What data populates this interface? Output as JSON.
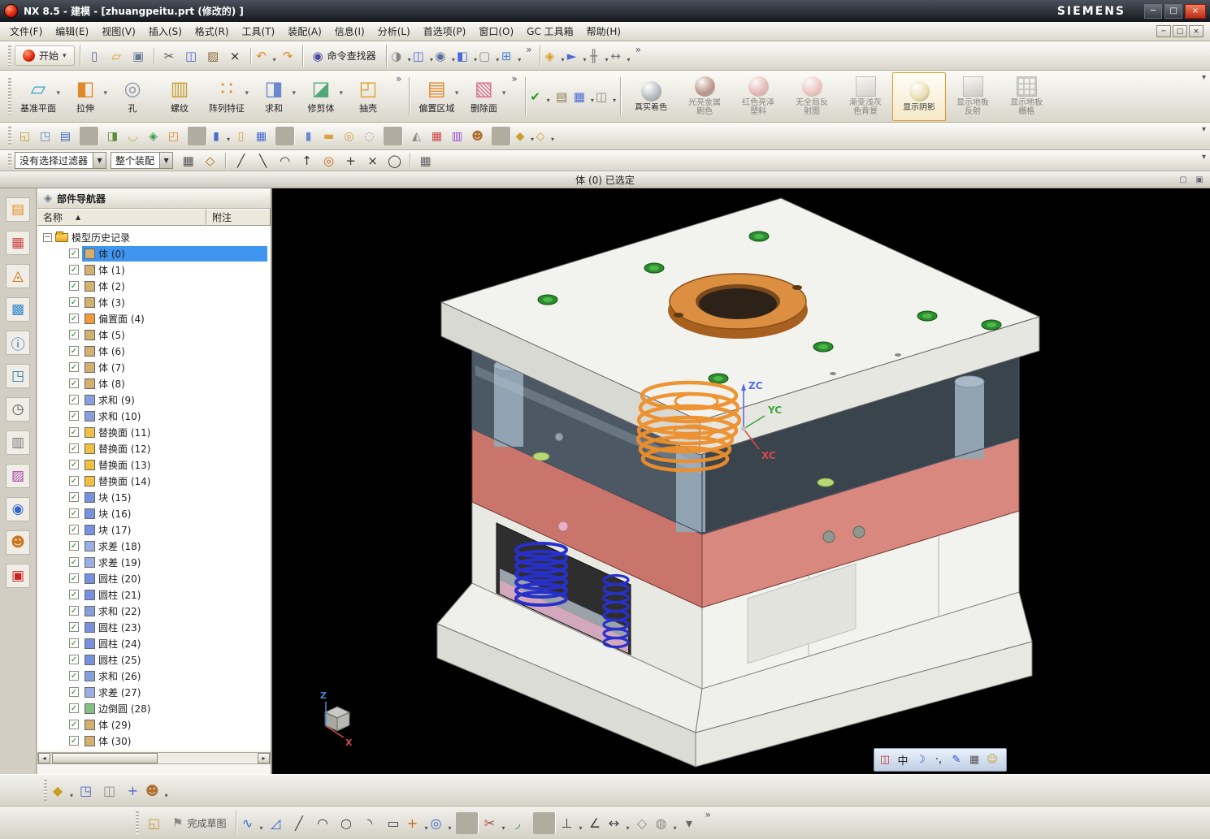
{
  "ui": {
    "overflow_glyph": "»"
  },
  "title_bar": {
    "app_title": "NX 8.5 - 建模 - [zhuangpeitu.prt (修改的) ]",
    "brand": "SIEMENS",
    "buttons": {
      "minimize": "─",
      "restore": "□",
      "close": "×"
    }
  },
  "menu_bar": {
    "items": [
      {
        "name": "menu-file",
        "label": "文件(F)"
      },
      {
        "name": "menu-edit",
        "label": "编辑(E)"
      },
      {
        "name": "menu-view",
        "label": "视图(V)"
      },
      {
        "name": "menu-insert",
        "label": "插入(S)"
      },
      {
        "name": "menu-format",
        "label": "格式(R)"
      },
      {
        "name": "menu-tools",
        "label": "工具(T)"
      },
      {
        "name": "menu-assemblies",
        "label": "装配(A)"
      },
      {
        "name": "menu-information",
        "label": "信息(I)"
      },
      {
        "name": "menu-analysis",
        "label": "分析(L)"
      },
      {
        "name": "menu-preferences",
        "label": "首选项(P)"
      },
      {
        "name": "menu-window",
        "label": "窗口(O)"
      },
      {
        "name": "menu-gc-toolbox",
        "label": "GC 工具箱"
      },
      {
        "name": "menu-help",
        "label": "帮助(H)"
      }
    ],
    "doc_buttons": {
      "minimize": "─",
      "restore": "□",
      "close": "×"
    }
  },
  "toolbar_main": {
    "start_label": "开始",
    "finder_glyph": "◉",
    "command_finder_label": "命令查找器",
    "icons_file": [
      {
        "name": "new-file-icon",
        "glyph": "▯",
        "fg": "#5a6a9a"
      },
      {
        "name": "open-icon",
        "glyph": "▱",
        "fg": "#d8a020"
      },
      {
        "name": "save-icon",
        "glyph": "▣",
        "fg": "#6a7a92"
      },
      {
        "sep": true
      },
      {
        "name": "cut-icon",
        "glyph": "✂",
        "fg": "#555555"
      },
      {
        "name": "copy-icon",
        "glyph": "◫",
        "fg": "#4a6ad8"
      },
      {
        "name": "paste-icon",
        "glyph": "▨",
        "fg": "#8a6a3a"
      },
      {
        "name": "delete-icon",
        "glyph": "×",
        "fg": "#222222"
      },
      {
        "sep": true
      },
      {
        "name": "undo-icon",
        "glyph": "↶",
        "fg": "#e08a20",
        "dd": true
      },
      {
        "name": "redo-icon",
        "glyph": "↷",
        "fg": "#e08a20"
      }
    ],
    "icons_view": [
      {
        "name": "rendering-style-icon",
        "glyph": "◑",
        "fg": "#888888",
        "dd": true
      },
      {
        "name": "window-layout-icon",
        "glyph": "◫",
        "fg": "#4a6ad8",
        "dd": true
      },
      {
        "name": "fit-view-icon",
        "glyph": "◉",
        "fg": "#5a6a9a",
        "dd": true
      },
      {
        "name": "cube-view-icon",
        "glyph": "◧",
        "fg": "#4a6ad8",
        "dd": true
      },
      {
        "name": "pane-icon",
        "glyph": "▢",
        "fg": "#888888",
        "dd": true
      },
      {
        "name": "new-window-icon",
        "glyph": "⊞",
        "fg": "#4a8ad8",
        "dd": true
      }
    ],
    "icons_tools": [
      {
        "name": "visualization-icon",
        "glyph": "◈",
        "fg": "#d8a020",
        "dd": true
      },
      {
        "name": "navigate-icon",
        "glyph": "►",
        "fg": "#4a6ad8",
        "dd": true
      },
      {
        "name": "measure-distance-icon",
        "glyph": "╫",
        "fg": "#777777",
        "dd": true
      },
      {
        "name": "ruler-icon",
        "glyph": "↔",
        "fg": "#777777",
        "dd": true
      }
    ]
  },
  "feature_toolbar": {
    "buttons": [
      {
        "name": "datum-plane-button",
        "label": "基准平面",
        "glyph": "▱",
        "fg": "#38a0c8",
        "dd": true
      },
      {
        "name": "extrude-button",
        "label": "拉伸",
        "glyph": "◧",
        "fg": "#e0882a",
        "dd": true
      },
      {
        "name": "hole-button",
        "label": "孔",
        "glyph": "◎",
        "fg": "#8a98a8"
      },
      {
        "name": "thread-button",
        "label": "螺纹",
        "glyph": "▥",
        "fg": "#c8a030"
      },
      {
        "name": "pattern-feature-button",
        "label": "阵列特征",
        "glyph": "∷",
        "fg": "#e0882a",
        "dd": true
      },
      {
        "name": "unite-button",
        "label": "求和",
        "glyph": "◨",
        "fg": "#6a8ad0",
        "dd": true
      },
      {
        "name": "trim-body-button",
        "label": "修剪体",
        "glyph": "◪",
        "fg": "#50a878",
        "dd": true
      },
      {
        "name": "shell-button",
        "label": "抽壳",
        "glyph": "◰",
        "fg": "#e0a02a"
      }
    ],
    "buttons2": [
      {
        "name": "offset-region-button",
        "label": "偏置区域",
        "glyph": "▤",
        "fg": "#e0882a",
        "dd": true
      },
      {
        "name": "delete-face-button",
        "label": "删除面",
        "glyph": "▧",
        "fg": "#d86a8a",
        "dd": true
      }
    ],
    "mid_icons": [
      {
        "name": "ok-check-icon",
        "glyph": "✔",
        "fg": "#2a9a2a",
        "dd": true
      },
      {
        "name": "spreadsheet-icon",
        "glyph": "▤",
        "fg": "#8a7a50"
      },
      {
        "name": "grid-tool-icon",
        "glyph": "▦",
        "fg": "#4a6ad8",
        "dd": true
      },
      {
        "name": "measure-tool-icon",
        "glyph": "◫",
        "fg": "#888888",
        "dd": true
      }
    ]
  },
  "render_toolbar": {
    "buttons": [
      {
        "name": "true-shading-button",
        "label": "真实着色",
        "kind": "sphere",
        "fg": "#b4b8bc",
        "on": true,
        "dd": false
      },
      {
        "name": "bright-metal-button",
        "label": "光亮金属刷色",
        "kind": "sphere",
        "fg": "#8a4a3a"
      },
      {
        "name": "red-gloss-plastic-button",
        "label": "红色亮泽塑料",
        "kind": "sphere",
        "fg": "#d88a8a"
      },
      {
        "name": "no-global-reflection-button",
        "label": "无全局反射图",
        "kind": "sphere",
        "fg": "#e8a0a0"
      },
      {
        "name": "gradient-gray-background-button",
        "label": "渐变浅灰色背景",
        "kind": "square",
        "fg": "#bcbcbc"
      },
      {
        "name": "show-shadow-button",
        "label": "显示阴影",
        "kind": "sphere",
        "fg": "#e8ddb0",
        "active": true
      },
      {
        "name": "floor-reflection-button",
        "label": "显示地板反射",
        "kind": "square",
        "fg": "#b0b0b0"
      },
      {
        "name": "floor-grid-button",
        "label": "显示地板栅格",
        "kind": "grid",
        "fg": "#a8a8a8"
      }
    ]
  },
  "toolbar_row3": {
    "icons": [
      {
        "name": "sketch-icon",
        "glyph": "◱",
        "fg": "#c89a30"
      },
      {
        "name": "datum-csys-icon",
        "glyph": "◳",
        "fg": "#4a8ac8"
      },
      {
        "name": "layer-settings-icon",
        "glyph": "▤",
        "fg": "#3a6ac8"
      },
      {
        "sep": true
      },
      {
        "name": "unite-small-icon",
        "glyph": "◨",
        "fg": "#5a8a3a"
      },
      {
        "name": "edge-blend-small-icon",
        "glyph": "◡",
        "fg": "#c8a030"
      },
      {
        "name": "assembly-constraints-icon",
        "glyph": "◈",
        "fg": "#3a9a5a"
      },
      {
        "name": "move-component-icon",
        "glyph": "◰",
        "fg": "#e0882a"
      },
      {
        "sep": true
      },
      {
        "name": "extrude-small-icon",
        "glyph": "▮",
        "fg": "#4a6ad8",
        "dd": true
      },
      {
        "name": "revolve-small-icon",
        "glyph": "▯",
        "fg": "#d8a040"
      },
      {
        "name": "expression-table-icon",
        "glyph": "▦",
        "fg": "#4a6ad8"
      },
      {
        "sep": true
      },
      {
        "name": "cylinder-tool-icon",
        "glyph": "▮",
        "fg": "#6a8ad8"
      },
      {
        "name": "capsule-tool-icon",
        "glyph": "▬",
        "fg": "#d8a040"
      },
      {
        "name": "torus-tool-icon",
        "glyph": "◎",
        "fg": "#d8a040"
      },
      {
        "name": "chain-tool-icon",
        "glyph": "◌",
        "fg": "#9a9a9a"
      },
      {
        "sep": true
      },
      {
        "name": "triangle-tool-icon",
        "glyph": "◭",
        "fg": "#888888"
      },
      {
        "name": "annotation-grid-icon",
        "glyph": "▦",
        "fg": "#cc4444"
      },
      {
        "name": "part-families-icon",
        "glyph": "▥",
        "fg": "#9a4ad0"
      },
      {
        "name": "roles-icon",
        "glyph": "☻",
        "fg": "#b07030"
      },
      {
        "sep": true
      },
      {
        "name": "wcs-icon",
        "glyph": "◆",
        "fg": "#c8a030",
        "dd": true
      },
      {
        "name": "wcs-dynamics-icon",
        "glyph": "◇",
        "fg": "#c8a030",
        "dd": true
      }
    ]
  },
  "selection_bar": {
    "filter_value": "没有选择过滤器",
    "scope_value": "整个装配",
    "snap_icons": [
      {
        "name": "selection-scope-icon",
        "glyph": "▦",
        "fg": "#555555"
      },
      {
        "name": "snap-settings-icon",
        "glyph": "◇",
        "fg": "#b06a1a"
      },
      {
        "sep": true
      },
      {
        "name": "snap-endpoint-icon",
        "glyph": "╱",
        "fg": "#333333"
      },
      {
        "name": "snap-midpoint-icon",
        "glyph": "╲",
        "fg": "#333333"
      },
      {
        "name": "snap-arc-icon",
        "glyph": "◠",
        "fg": "#333333"
      },
      {
        "name": "snap-pole-icon",
        "glyph": "↑",
        "fg": "#333333"
      },
      {
        "name": "snap-center-icon",
        "glyph": "◎",
        "fg": "#c86a1a"
      },
      {
        "name": "snap-intersection-icon",
        "glyph": "+",
        "fg": "#333333"
      },
      {
        "name": "snap-cross-icon",
        "glyph": "×",
        "fg": "#333333"
      },
      {
        "name": "snap-circle-icon",
        "glyph": "◯",
        "fg": "#333333"
      },
      {
        "sep": true
      },
      {
        "name": "grid-snap-icon",
        "glyph": "▦",
        "fg": "#666666"
      }
    ]
  },
  "status_bar": {
    "message": "体 (0) 已选定",
    "icons": [
      {
        "name": "status-pane-icon",
        "glyph": "▢",
        "fg": "#667788"
      },
      {
        "name": "status-dock-icon",
        "glyph": "▣",
        "fg": "#667788"
      }
    ]
  },
  "resource_bar": {
    "icons": [
      {
        "name": "assembly-navigator-icon",
        "glyph": "▤",
        "fg": "#e09020"
      },
      {
        "name": "constraint-navigator-icon",
        "glyph": "▦",
        "fg": "#cc4444"
      },
      {
        "name": "part-navigator-icon",
        "glyph": "◬",
        "fg": "#cc6600"
      },
      {
        "name": "reuse-library-icon",
        "glyph": "▩",
        "fg": "#3388cc"
      },
      {
        "name": "hd3d-tools-icon",
        "glyph": "ⓘ",
        "fg": "#2266cc"
      },
      {
        "name": "web-browser-icon",
        "glyph": "◳",
        "fg": "#3377aa"
      },
      {
        "name": "history-palette-icon",
        "glyph": "◷",
        "fg": "#555555"
      },
      {
        "name": "process-studio-icon",
        "glyph": "▥",
        "fg": "#777777"
      },
      {
        "name": "manufacturing-wizard-icon",
        "glyph": "▨",
        "fg": "#aa44aa"
      },
      {
        "name": "roles-palette-icon",
        "glyph": "◉",
        "fg": "#3366cc"
      },
      {
        "name": "system-scenes-icon",
        "glyph": "☻",
        "fg": "#cc7722"
      },
      {
        "name": "materials-icon",
        "glyph": "▣",
        "fg": "#cc2222"
      }
    ]
  },
  "navigator": {
    "title": "部件导航器",
    "header_glyph": "◈",
    "sort_glyph": "▲",
    "columns": {
      "name": "名称",
      "note": "附注"
    },
    "root_label": "模型历史记录",
    "items": [
      {
        "label": "体 (0)",
        "type": "body",
        "selected": true
      },
      {
        "label": "体 (1)",
        "type": "body"
      },
      {
        "label": "体 (2)",
        "type": "body"
      },
      {
        "label": "体 (3)",
        "type": "body"
      },
      {
        "label": "偏置面 (4)",
        "type": "offset"
      },
      {
        "label": "体 (5)",
        "type": "body"
      },
      {
        "label": "体 (6)",
        "type": "body"
      },
      {
        "label": "体 (7)",
        "type": "body"
      },
      {
        "label": "体 (8)",
        "type": "body"
      },
      {
        "label": "求和 (9)",
        "type": "unite"
      },
      {
        "label": "求和 (10)",
        "type": "unite"
      },
      {
        "label": "替换面 (11)",
        "type": "replace"
      },
      {
        "label": "替换面 (12)",
        "type": "replace"
      },
      {
        "label": "替换面 (13)",
        "type": "replace"
      },
      {
        "label": "替换面 (14)",
        "type": "replace"
      },
      {
        "label": "块 (15)",
        "type": "block"
      },
      {
        "label": "块 (16)",
        "type": "block"
      },
      {
        "label": "块 (17)",
        "type": "block"
      },
      {
        "label": "求差 (18)",
        "type": "subtract"
      },
      {
        "label": "求差 (19)",
        "type": "subtract"
      },
      {
        "label": "圆柱 (20)",
        "type": "cylinder"
      },
      {
        "label": "圆柱 (21)",
        "type": "cylinder"
      },
      {
        "label": "求和 (22)",
        "type": "unite"
      },
      {
        "label": "圆柱 (23)",
        "type": "cylinder"
      },
      {
        "label": "圆柱 (24)",
        "type": "cylinder"
      },
      {
        "label": "圆柱 (25)",
        "type": "cylinder"
      },
      {
        "label": "求和 (26)",
        "type": "unite"
      },
      {
        "label": "求差 (27)",
        "type": "subtract"
      },
      {
        "label": "边倒圆 (28)",
        "type": "blend"
      },
      {
        "label": "体 (29)",
        "type": "body"
      },
      {
        "label": "体 (30)",
        "type": "body"
      }
    ]
  },
  "viewport": {
    "triad": {
      "z_label": "ZC",
      "y_label": "YC",
      "x_label": "XC"
    },
    "mini_triad": {
      "z_label": "Z",
      "x_label": "X"
    },
    "ime_bar": {
      "items": [
        {
          "name": "ime-logo-icon",
          "glyph": "◫",
          "fg": "#c03030"
        },
        {
          "name": "ime-language-icon",
          "glyph": "中",
          "fg": "#222222"
        },
        {
          "name": "ime-mode-icon",
          "glyph": "☽",
          "fg": "#2a4ad0"
        },
        {
          "name": "ime-punctuation-icon",
          "glyph": "·,",
          "fg": "#222222"
        },
        {
          "name": "ime-tools-icon",
          "glyph": "✎",
          "fg": "#2a4ad0"
        },
        {
          "name": "ime-keyboard-icon",
          "glyph": "▦",
          "fg": "#555555"
        },
        {
          "name": "ime-smiley-icon",
          "glyph": "☺",
          "fg": "#c8a020"
        }
      ]
    }
  },
  "bottom_toolbar": {
    "icons": [
      {
        "name": "new-component-icon",
        "glyph": "◆",
        "fg": "#c8a020",
        "dd": true
      },
      {
        "name": "export-component-icon",
        "glyph": "◳",
        "fg": "#4a6ac8"
      },
      {
        "name": "window-tile-icon",
        "glyph": "◫",
        "fg": "#888888"
      },
      {
        "name": "move-view-icon",
        "glyph": "+",
        "fg": "#4a6ac8"
      },
      {
        "name": "team-roles-icon",
        "glyph": "☻",
        "fg": "#b07030",
        "dd": true
      }
    ]
  },
  "sketch_toolbar": {
    "env_icon": {
      "glyph": "◱",
      "fg": "#c89a30"
    },
    "finish_flag_glyph": "⚑",
    "finish_label": "完成草图",
    "icons": [
      {
        "name": "profile-icon",
        "glyph": "∿",
        "fg": "#3a6ac8",
        "dd": true
      },
      {
        "name": "polyline-icon",
        "glyph": "◿",
        "fg": "#3a6ac8"
      },
      {
        "name": "line-icon",
        "glyph": "╱",
        "fg": "#444444"
      },
      {
        "name": "arc-icon",
        "glyph": "◠",
        "fg": "#444444"
      },
      {
        "name": "circle-icon",
        "glyph": "○",
        "fg": "#444444"
      },
      {
        "name": "fillet-icon",
        "glyph": "◝",
        "fg": "#444444"
      },
      {
        "name": "rectangle-icon",
        "glyph": "▭",
        "fg": "#444444"
      },
      {
        "name": "point-icon",
        "glyph": "+",
        "fg": "#c86a1a",
        "dd": true
      },
      {
        "name": "offset-curve-icon",
        "glyph": "◎",
        "fg": "#3a6ac8",
        "dd": true
      },
      {
        "sep": true
      },
      {
        "name": "quick-trim-icon",
        "glyph": "✂",
        "fg": "#b04a3a",
        "dd": true
      },
      {
        "name": "quick-extend-icon",
        "glyph": "◞",
        "fg": "#3a8a5a"
      },
      {
        "sep": true
      },
      {
        "name": "geometric-constraints-icon",
        "glyph": "⊥",
        "fg": "#444444",
        "dd": true
      },
      {
        "name": "angle-constraint-icon",
        "glyph": "∠",
        "fg": "#444444"
      },
      {
        "name": "dimension-icon",
        "glyph": "↔",
        "fg": "#444444",
        "dd": true
      },
      {
        "name": "style-state-icon",
        "glyph": "◇",
        "fg": "#888888"
      },
      {
        "name": "display-constraints-icon",
        "glyph": "◍",
        "fg": "#888888",
        "dd": true
      },
      {
        "name": "more-options-icon",
        "glyph": "▾",
        "fg": "#666666"
      }
    ]
  },
  "model": {
    "colors": {
      "top_plate": "#f2f2ee",
      "top_plate_left": "#d9d9d3",
      "top_plate_right": "#e7e7e1",
      "ring": "#dd8f41",
      "ring_dark": "#a86020",
      "cavity": "#8aa2b8",
      "red_left": "#c9756c",
      "red_right": "#d8887f",
      "housing": "#e9e9e4",
      "housing_right": "#f2f2ee",
      "base_top": "#efefeb",
      "base_left": "#dcdcd6",
      "base_right": "#e8e8e2",
      "spring_blue": "#2830cc",
      "coil_orange": "#ef8f2a",
      "screw": "#2d8c2d",
      "screw_light": "#4cb84c",
      "ejector_pink": "#d4a8bc",
      "support_gray": "#9aa2aa",
      "pillar": "#9aa4ac",
      "zc": "#5a6ae8",
      "yc": "#3aa83a",
      "xc": "#d84848"
    }
  }
}
